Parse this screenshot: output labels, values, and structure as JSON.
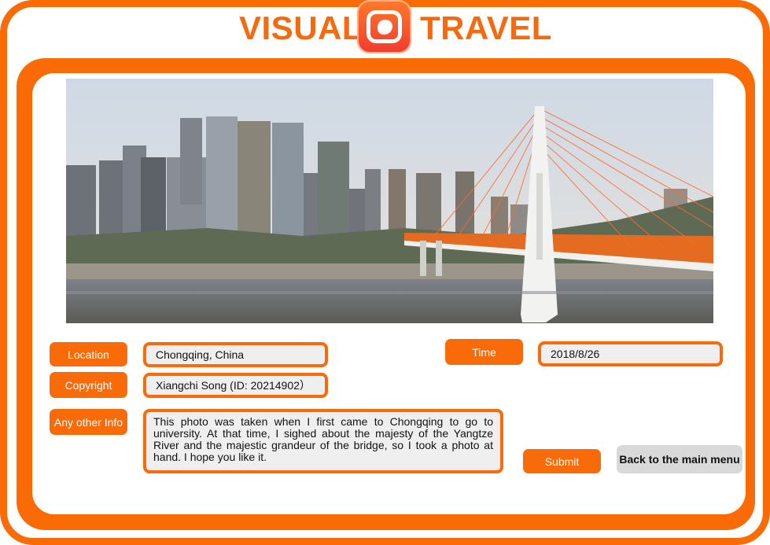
{
  "header": {
    "title_left": "VISUAL",
    "title_right": "TRAVEL",
    "logo_icon": "camera-app-logo-icon"
  },
  "photo": {
    "description_icon": "chongqing-bridge-photo"
  },
  "form": {
    "location_label": "Location",
    "location_value": "Chongqing, China",
    "time_label": "Time",
    "time_value": "2018/8/26",
    "copyright_label": "Copyright",
    "copyright_value": "Xiangchi Song (ID: 20214902）",
    "other_info_label": "Any other Info",
    "other_info_value": "This photo was taken when I first came to Chongqing to go to university. At that time, I sighed about the majesty of the Yangtze River and the majestic grandeur of the bridge, so I took a photo at hand. I hope you like it."
  },
  "actions": {
    "submit_label": "Submit",
    "back_label": "Back to the main menu"
  },
  "colors": {
    "accent": "#f96b08",
    "button_gray": "#d9d9d9",
    "field_bg": "#efefef"
  }
}
